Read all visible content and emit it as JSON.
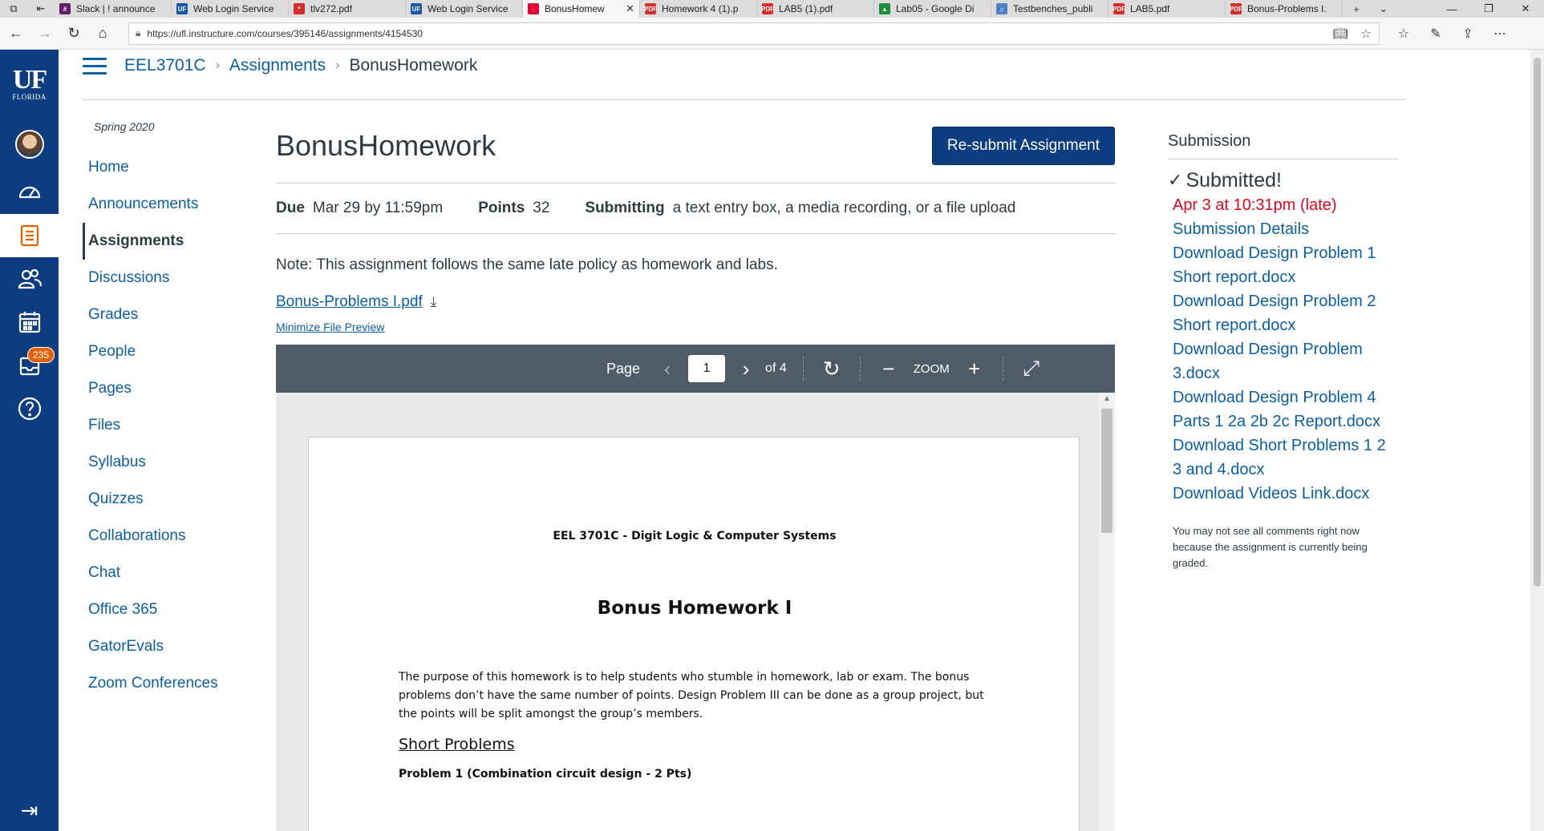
{
  "browser": {
    "tabs": [
      {
        "title": "Slack | ! announce",
        "icon_color": "#611f69",
        "icon_text": "#"
      },
      {
        "title": "Web Login Service",
        "icon_color": "#1a57a8",
        "icon_text": "UF"
      },
      {
        "title": "tlv272.pdf",
        "icon_color": "#d32f2f",
        "icon_text": "*"
      },
      {
        "title": "Web Login Service",
        "icon_color": "#1a57a8",
        "icon_text": "UF"
      },
      {
        "title": "BonusHomew",
        "icon_color": "#e0062f",
        "icon_text": "◌",
        "active": true
      },
      {
        "title": "Homework 4 (1).p",
        "icon_color": "#d32f2f",
        "icon_text": "PDF"
      },
      {
        "title": "LAB5 (1).pdf",
        "icon_color": "#d32f2f",
        "icon_text": "PDF"
      },
      {
        "title": "Lab05 - Google Di",
        "icon_color": "#1e8e3e",
        "icon_text": "▲"
      },
      {
        "title": "Testbenches_publi",
        "icon_color": "#4c80c9",
        "icon_text": "⌂"
      },
      {
        "title": "LAB5.pdf",
        "icon_color": "#d32f2f",
        "icon_text": "PDF"
      },
      {
        "title": "Bonus-Problems I.",
        "icon_color": "#d32f2f",
        "icon_text": "PDF"
      }
    ],
    "url": "https://ufl.instructure.com/courses/395146/assignments/4154530"
  },
  "global_nav": {
    "logo_main": "UF",
    "logo_sub": "FLORIDA",
    "inbox_badge": "235"
  },
  "breadcrumb": {
    "course": "EEL3701C",
    "section": "Assignments",
    "current": "BonusHomework"
  },
  "course_nav": {
    "term": "Spring 2020",
    "items": [
      "Home",
      "Announcements",
      "Assignments",
      "Discussions",
      "Grades",
      "People",
      "Pages",
      "Files",
      "Syllabus",
      "Quizzes",
      "Collaborations",
      "Chat",
      "Office 365",
      "GatorEvals",
      "Zoom Conferences"
    ],
    "active": "Assignments"
  },
  "assignment": {
    "title": "BonusHomework",
    "resubmit_label": "Re-submit Assignment",
    "due_label": "Due",
    "due_value": "Mar 29 by 11:59pm",
    "points_label": "Points",
    "points_value": "32",
    "submitting_label": "Submitting",
    "submitting_value": "a text entry box, a media recording, or a file upload",
    "note": "Note: This assignment follows the same late policy as homework and labs.",
    "file_name": "Bonus-Problems I.pdf",
    "minimize_label": "Minimize File Preview"
  },
  "viewer": {
    "page_label": "Page",
    "page_value": "1",
    "of_label": "of 4",
    "zoom_label": "ZOOM"
  },
  "pdf": {
    "course": "EEL 3701C - Digit Logic & Computer Systems",
    "title": "Bonus Homework I",
    "paragraph": "The purpose of this homework is to help students who stumble in homework, lab or exam. The bonus problems don’t have the same number of points. Design Problem III can be done as a group project, but the points will be split amongst the group’s members.",
    "section": "Short Problems",
    "problem1": "Problem 1 (Combination circuit design - 2 Pts)"
  },
  "submission": {
    "heading": "Submission",
    "status": "Submitted!",
    "date": "Apr 3 at 10:31pm (late)",
    "details_link": "Submission Details",
    "downloads": [
      "Download Design Problem 1 Short report.docx",
      "Download Design Problem 2 Short report.docx",
      "Download Design Problem 3.docx",
      "Download Design Problem 4 Parts 1 2a 2b 2c Report.docx",
      "Download Short Problems 1 2 3 and 4.docx",
      "Download Videos Link.docx"
    ],
    "note": "You may not see all comments right now because the assignment is currently being graded."
  },
  "colors": {
    "nav_bg": "#0b3d80",
    "link": "#0b5fa5",
    "late": "#e0061f",
    "badge": "#e66000",
    "viewer_toolbar": "#4f5b66"
  }
}
